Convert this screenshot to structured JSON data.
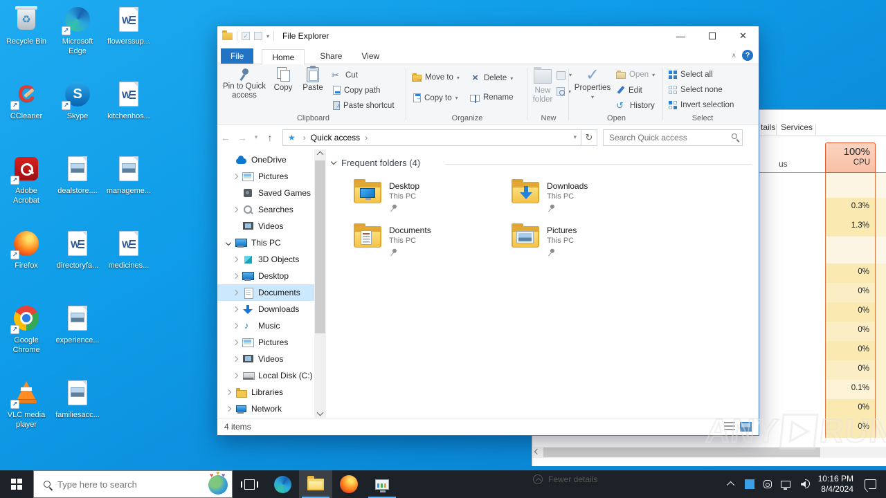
{
  "desktop": {
    "icons": [
      {
        "type": "recycle",
        "label": "Recycle Bin",
        "shortcut": false
      },
      {
        "type": "edge",
        "label": "Microsoft Edge",
        "shortcut": true
      },
      {
        "type": "word",
        "label": "flowerssup...",
        "shortcut": false
      },
      {
        "type": "ccleaner",
        "label": "CCleaner",
        "shortcut": true
      },
      {
        "type": "skype",
        "label": "Skype",
        "shortcut": true
      },
      {
        "type": "word",
        "label": "kitchenhos...",
        "shortcut": false
      },
      {
        "type": "acrobat",
        "label": "Adobe Acrobat",
        "shortcut": true
      },
      {
        "type": "img",
        "label": "dealstore....",
        "shortcut": false
      },
      {
        "type": "img",
        "label": "manageme...",
        "shortcut": false
      },
      {
        "type": "firefox",
        "label": "Firefox",
        "shortcut": true
      },
      {
        "type": "word",
        "label": "directoryfa...",
        "shortcut": false
      },
      {
        "type": "word",
        "label": "medicines...",
        "shortcut": false
      },
      {
        "type": "chrome",
        "label": "Google Chrome",
        "shortcut": true
      },
      {
        "type": "img",
        "label": "experience...",
        "shortcut": false
      },
      {
        "type": "vlc",
        "label": "VLC media player",
        "shortcut": true
      },
      {
        "type": "img",
        "label": "familiesacc...",
        "shortcut": false
      }
    ]
  },
  "explorer": {
    "title": "File Explorer",
    "tabs": {
      "file": "File",
      "home": "Home",
      "share": "Share",
      "view": "View"
    },
    "ribbon": {
      "clipboard": {
        "label": "Clipboard",
        "pin": "Pin to Quick access",
        "copy": "Copy",
        "paste": "Paste",
        "cut": "Cut",
        "copy_path": "Copy path",
        "paste_shortcut": "Paste shortcut"
      },
      "organize": {
        "label": "Organize",
        "move_to": "Move to",
        "copy_to": "Copy to",
        "delete": "Delete",
        "rename": "Rename"
      },
      "new_group": {
        "label": "New",
        "new_folder": "New folder"
      },
      "open_group": {
        "label": "Open",
        "properties": "Properties",
        "open": "Open",
        "edit": "Edit",
        "history": "History"
      },
      "select_group": {
        "label": "Select",
        "select_all": "Select all",
        "select_none": "Select none",
        "invert": "Invert selection"
      }
    },
    "address": {
      "crumb": "Quick access",
      "search_placeholder": "Search Quick access"
    },
    "nav": [
      {
        "label": "OneDrive",
        "icon": "cloud",
        "level": 1,
        "exp": "none"
      },
      {
        "label": "Pictures",
        "icon": "pic",
        "level": 2,
        "exp": "right"
      },
      {
        "label": "Saved Games",
        "icon": "games",
        "level": 2,
        "exp": "none"
      },
      {
        "label": "Searches",
        "icon": "search",
        "level": 2,
        "exp": "right"
      },
      {
        "label": "Videos",
        "icon": "video",
        "level": 2,
        "exp": "none"
      },
      {
        "label": "This PC",
        "icon": "pc",
        "level": 1,
        "exp": "down"
      },
      {
        "label": "3D Objects",
        "icon": "cube",
        "level": 2,
        "exp": "right"
      },
      {
        "label": "Desktop",
        "icon": "pc",
        "level": 2,
        "exp": "right"
      },
      {
        "label": "Documents",
        "icon": "docs",
        "level": 2,
        "exp": "right",
        "selected": true
      },
      {
        "label": "Downloads",
        "icon": "down",
        "level": 2,
        "exp": "right"
      },
      {
        "label": "Music",
        "icon": "music",
        "level": 2,
        "exp": "right"
      },
      {
        "label": "Pictures",
        "icon": "pic",
        "level": 2,
        "exp": "right"
      },
      {
        "label": "Videos",
        "icon": "video",
        "level": 2,
        "exp": "right"
      },
      {
        "label": "Local Disk (C:)",
        "icon": "disk",
        "level": 2,
        "exp": "right"
      },
      {
        "label": "Libraries",
        "icon": "lib",
        "level": 1,
        "exp": "right"
      },
      {
        "label": "Network",
        "icon": "net",
        "level": 1,
        "exp": "right"
      }
    ],
    "content": {
      "group_header": "Frequent folders (4)",
      "tiles": [
        {
          "name": "Desktop",
          "sub": "This PC",
          "glyph": "desktop"
        },
        {
          "name": "Downloads",
          "sub": "This PC",
          "glyph": "down"
        },
        {
          "name": "Documents",
          "sub": "This PC",
          "glyph": "doc"
        },
        {
          "name": "Pictures",
          "sub": "This PC",
          "glyph": "pic"
        }
      ]
    },
    "status": {
      "items": "4 items"
    }
  },
  "taskmanager": {
    "tab_details_fragment": "tails",
    "tab_services": "Services",
    "status_col_fragment": "us",
    "cpu_pct": "100%",
    "cpu_label": "CPU",
    "rows": [
      "",
      "0.3%",
      "1.3%",
      "",
      "0%",
      "0%",
      "0%",
      "0%",
      "0%",
      "0%",
      "0.1%",
      "0%",
      "0%"
    ],
    "fewer_details": "Fewer details"
  },
  "watermark": {
    "left": "ANY",
    "right": "RUN"
  },
  "taskbar": {
    "search_placeholder": "Type here to search",
    "clock_time": "10:16 PM",
    "clock_date": "8/4/2024"
  }
}
